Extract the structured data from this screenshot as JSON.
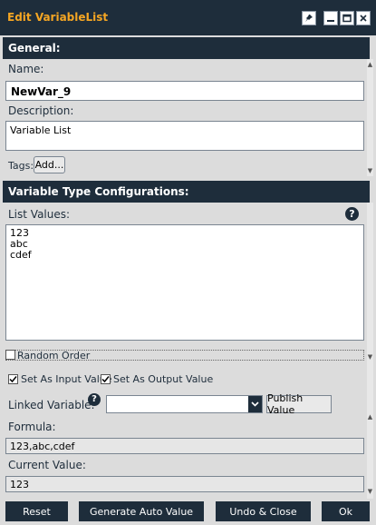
{
  "window": {
    "title": "Edit VariableList",
    "title_color": "#f5a623",
    "bar_color": "#1e2d3b",
    "controls": [
      "pin-icon",
      "minimize-icon",
      "maximize-icon",
      "close-icon"
    ]
  },
  "general": {
    "header": "General:",
    "name_label": "Name:",
    "name_value": "NewVar_9",
    "description_label": "Description:",
    "description_value": "Variable List",
    "tags_label": "Tags:",
    "add_button": "Add..."
  },
  "config": {
    "header": "Variable Type Configurations:",
    "list_values_label": "List Values:",
    "list_values": [
      "123",
      "abc",
      "cdef"
    ],
    "random_order_label": "Random Order",
    "random_order_checked": false,
    "input_value_label": "Set As Input Value",
    "input_value_checked": true,
    "output_value_label": "Set As Output Value",
    "output_value_checked": true,
    "linked_variable_label": "Linked Variable:",
    "linked_variable_value": "",
    "publish_button": "Publish Value",
    "formula_label": "Formula:",
    "formula_value": "123,abc,cdef",
    "current_value_label": "Current Value:",
    "current_value": "123"
  },
  "footer": {
    "reset": "Reset",
    "generate": "Generate Auto Value",
    "undo_close": "Undo & Close",
    "ok": "Ok"
  }
}
